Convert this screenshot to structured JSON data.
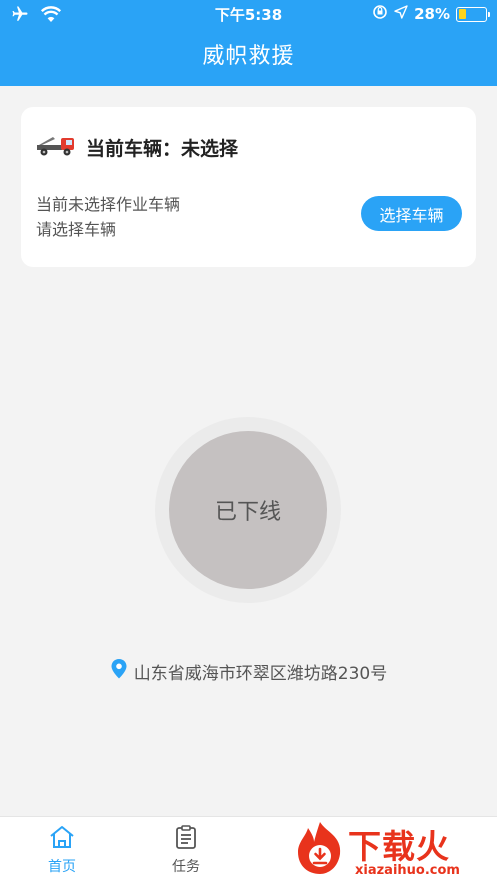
{
  "status_bar": {
    "time": "下午5:38",
    "battery_percent": "28%",
    "battery_level": 0.28,
    "icons": [
      "airplane-icon",
      "wifi-icon",
      "rotation-lock-icon",
      "location-arrow-icon",
      "battery-icon"
    ]
  },
  "navbar": {
    "title": "威帜救援"
  },
  "vehicle_card": {
    "title": "当前车辆：未选择",
    "desc_line1": "当前未选择作业车辆",
    "desc_line2": "请选择车辆",
    "select_button": "选择车辆",
    "icon": "tow-truck-icon"
  },
  "status_button": {
    "label": "已下线"
  },
  "location": {
    "address": "山东省威海市环翠区潍坊路230号",
    "icon": "location-pin-icon"
  },
  "tabs": [
    {
      "label": "首页",
      "icon": "home-icon",
      "active": true
    },
    {
      "label": "任务",
      "icon": "task-list-icon",
      "active": false
    }
  ],
  "watermark": {
    "text": "下载火",
    "sub": "xiazaihuo.com"
  },
  "colors": {
    "primary": "#2aa3f6",
    "background": "#f3f3f3",
    "status_circle": "#c5c1c1",
    "watermark": "#e8331c"
  }
}
